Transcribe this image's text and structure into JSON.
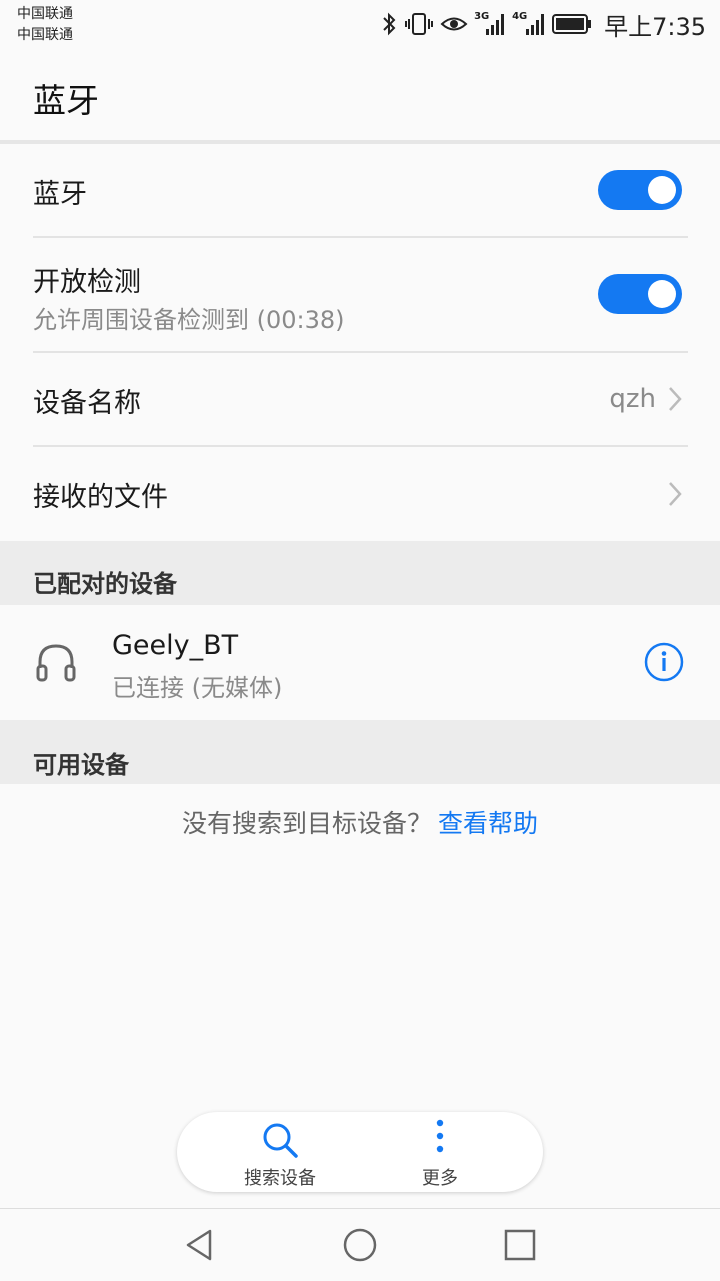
{
  "status_bar": {
    "carrier_1": "中国联通",
    "carrier_2": "中国联通",
    "net_1": "3G",
    "net_2": "4G",
    "time": "早上7:35"
  },
  "header": {
    "title": "蓝牙"
  },
  "settings": {
    "bluetooth": {
      "label": "蓝牙",
      "enabled": true
    },
    "visibility": {
      "label": "开放检测",
      "sub": "允许周围设备检测到 (00:38)",
      "enabled": true
    },
    "device_name": {
      "label": "设备名称",
      "value": "qzh"
    },
    "received_files": {
      "label": "接收的文件"
    }
  },
  "paired": {
    "section_label": "已配对的设备",
    "devices": [
      {
        "name": "Geely_BT",
        "status": "已连接 (无媒体)",
        "icon": "headset-icon"
      }
    ]
  },
  "available": {
    "section_label": "可用设备",
    "hint": "没有搜索到目标设备？",
    "help_link": "查看帮助"
  },
  "bottom_actions": {
    "search_label": "搜索设备",
    "more_label": "更多"
  },
  "colors": {
    "accent": "#1479f2",
    "section_bg": "#ececec"
  }
}
